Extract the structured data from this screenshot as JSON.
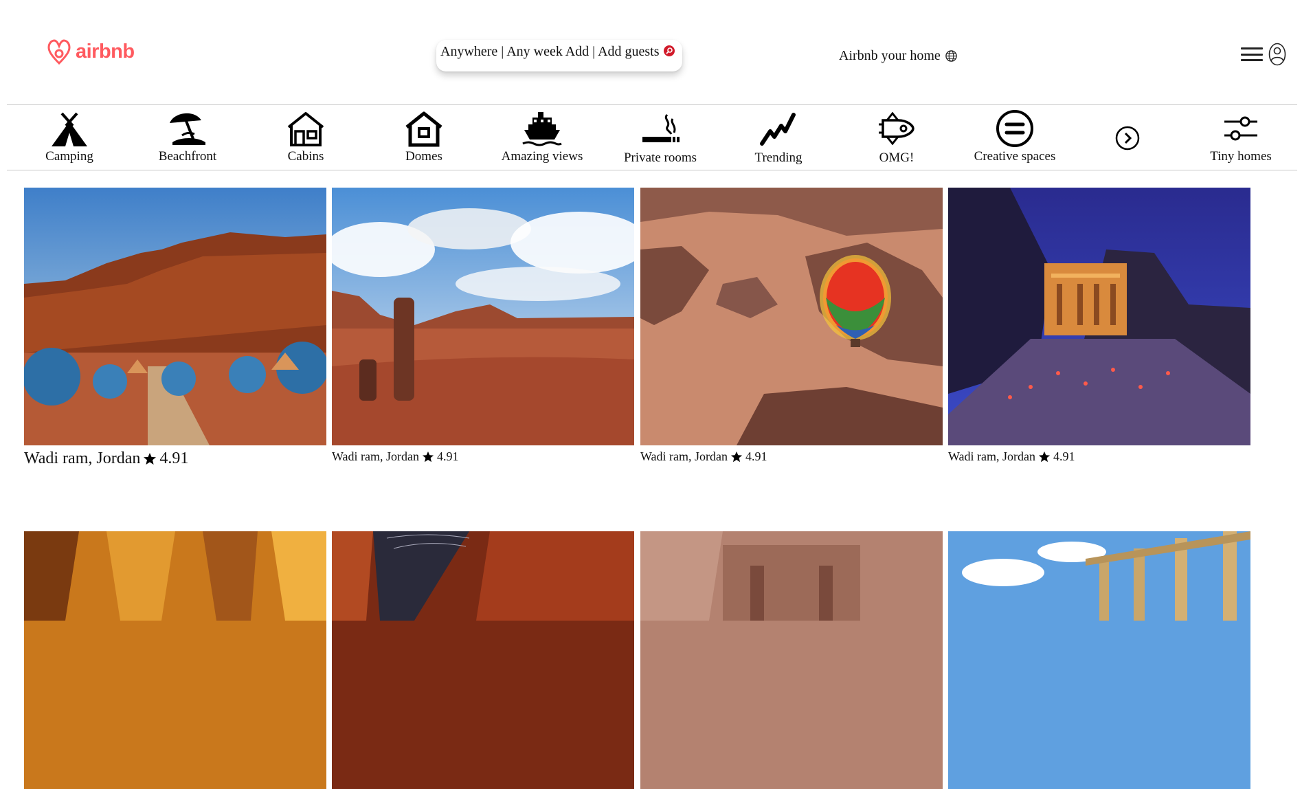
{
  "brand": {
    "name": "airbnb",
    "color": "#ff5a5f",
    "icon": "airbnb-logo-icon"
  },
  "search": {
    "label": "Anywhere | Any week Add | Add guests",
    "icon": "search-icon",
    "icon_color": "#d11a2a"
  },
  "host": {
    "label": "Airbnb your home",
    "icon": "globe-icon"
  },
  "menu": {
    "icons": [
      "hamburger-menu-icon",
      "user-avatar-icon"
    ]
  },
  "categories": [
    {
      "label": "Camping",
      "icon": "tent-icon"
    },
    {
      "label": "Beachfront",
      "icon": "beach-umbrella-icon"
    },
    {
      "label": "Cabins",
      "icon": "cabin-icon"
    },
    {
      "label": "Domes",
      "icon": "dome-house-icon"
    },
    {
      "label": "Amazing views",
      "icon": "ship-icon"
    },
    {
      "label": "Private rooms",
      "icon": "smoking-room-icon"
    },
    {
      "label": "Trending",
      "icon": "trending-icon"
    },
    {
      "label": "OMG!",
      "icon": "spaceship-icon"
    },
    {
      "label": "Creative spaces",
      "icon": "equals-circle-icon"
    },
    {
      "label": "Tiny homes",
      "icon": "sliders-icon"
    }
  ],
  "scroll_next_icon": "chevron-right-circle-icon",
  "listings": [
    {
      "location": "Wadi ram, Jordan",
      "rating": "4.91",
      "photo": "desert domes camp at sunset"
    },
    {
      "location": "Wadi ram, Jordan",
      "rating": "4.91",
      "photo": "rock stack in desert valley"
    },
    {
      "location": "Wadi ram, Jordan",
      "rating": "4.91",
      "photo": "hot air balloon over red canyons"
    },
    {
      "location": "Wadi ram, Jordan",
      "rating": "4.91",
      "photo": "Petra treasury at night with candles"
    },
    {
      "location": "",
      "rating": "",
      "photo": "orange sandstone cliff"
    },
    {
      "location": "",
      "rating": "",
      "photo": "star trails over red cliffs"
    },
    {
      "location": "",
      "rating": "",
      "photo": "carved tomb facade"
    },
    {
      "location": "",
      "rating": "",
      "photo": "roman columns colonnade"
    }
  ]
}
